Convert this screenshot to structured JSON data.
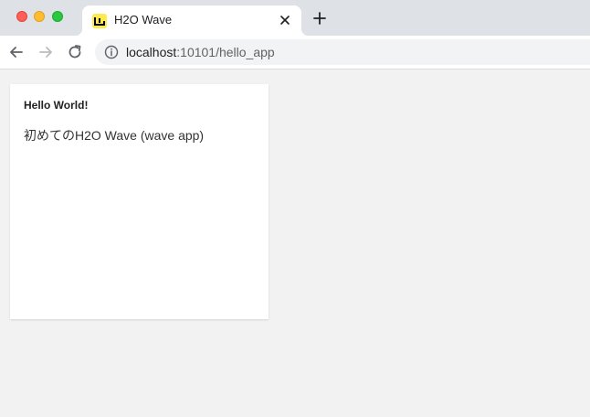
{
  "browser": {
    "tab": {
      "title": "H2O Wave",
      "favicon": "h2o-wave-logo"
    },
    "address": {
      "host": "localhost",
      "rest": ":10101/hello_app"
    }
  },
  "card": {
    "title": "Hello World!",
    "content": "初めてのH2O Wave (wave app)"
  }
}
